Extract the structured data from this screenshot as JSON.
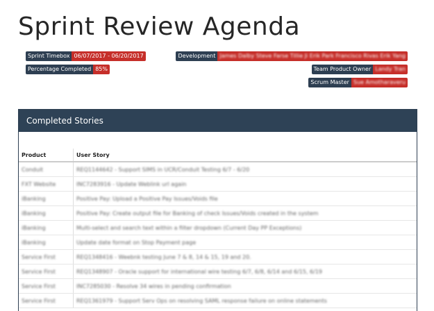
{
  "page": {
    "title": "Sprint Review Agenda"
  },
  "meta": {
    "sprint_timebox": {
      "label": "Sprint Timebox",
      "value": "06/07/2017 - 06/20/2017"
    },
    "percentage_completed": {
      "label": "Percentage Completed",
      "value": "85%"
    },
    "development": {
      "label": "Development",
      "value": "James Dalby  Steve Farse  Tillie Ji  Erik Park  Francisco Rivas  Erik Yang"
    },
    "team_product_owner": {
      "label": "Team Product Owner",
      "value": "Landy Tran"
    },
    "scrum_master": {
      "label": "Scrum Master",
      "value": "Sue Amotharaveru"
    }
  },
  "colors": {
    "key_bg": "#2e3f52",
    "value_bg": "#c62f2a",
    "panel_header": "#2e4256"
  },
  "completed_stories": {
    "header": "Completed Stories",
    "columns": [
      "Product",
      "User Story"
    ],
    "rows": [
      [
        "Conduit",
        "REQ1144642 - Support SIMS in UCR/Conduit Testing 6/7 - 6/20"
      ],
      [
        "FXT Website",
        "INC7283916 - Update Weblink url again"
      ],
      [
        "iBanking",
        "Positive Pay: Upload a Positive Pay Issues/Voids file"
      ],
      [
        "iBanking",
        "Positive Pay: Create output file for Banking of check Issues/Voids created in the system"
      ],
      [
        "iBanking",
        "Multi-select and search text within a filter dropdown (Current Day PP Exceptions)"
      ],
      [
        "iBanking",
        "Update date format on Stop Payment page"
      ],
      [
        "Service First",
        "REQ1348416 - Weebnk testing June 7 & 8, 14 & 15, 19 and 20."
      ],
      [
        "Service First",
        "REQ1348907 - Oracle support for international wire testing 6/7, 6/8, 6/14 and 6/15, 6/19"
      ],
      [
        "Service First",
        "INC7285030 - Resolve 34 wires in pending confirmation"
      ],
      [
        "Service First",
        "REQ1361979 - Support Serv Ops on resolving SAML response failure on online statements"
      ]
    ]
  }
}
